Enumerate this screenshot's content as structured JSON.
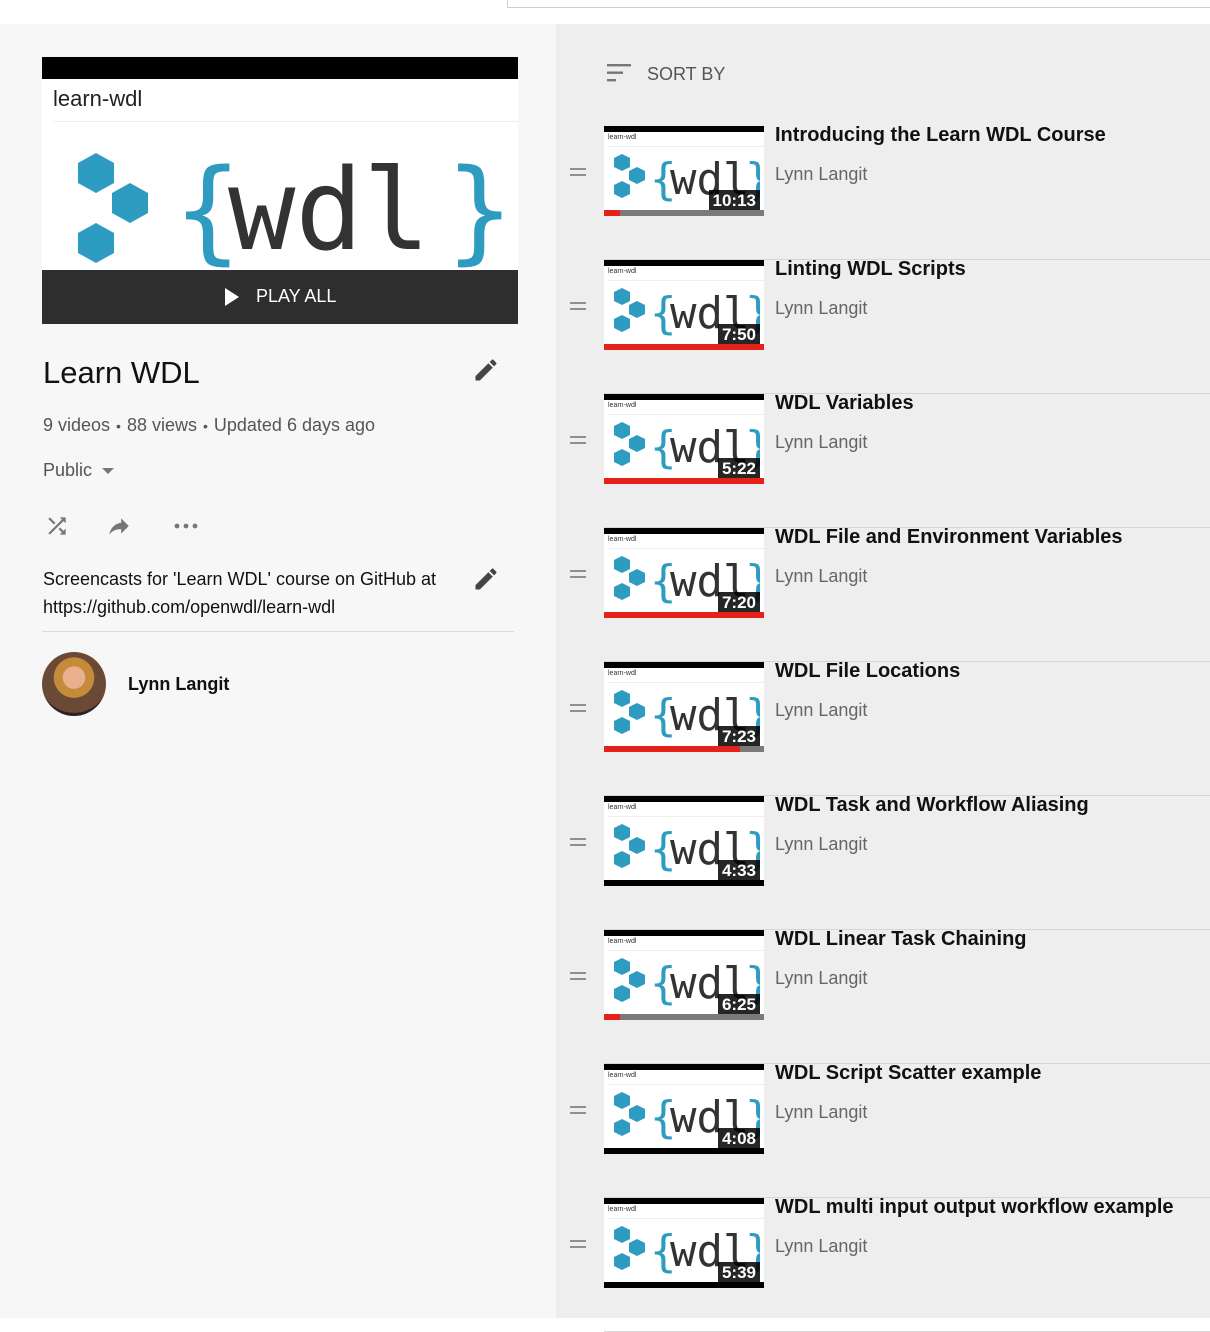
{
  "playlist": {
    "thumbnail_caption": "learn-wdl",
    "logo_text": "{wdl}",
    "play_all_label": "PLAY ALL",
    "title": "Learn WDL",
    "stats": {
      "videos": "9 videos",
      "views": "88 views",
      "updated": "Updated 6 days ago"
    },
    "privacy": "Public",
    "description": "Screencasts for 'Learn WDL' course on GitHub at https://github.com/openwdl/learn-wdl",
    "owner": "Lynn Langit"
  },
  "list": {
    "sort_label": "SORT BY",
    "videos": [
      {
        "title": "Introducing the Learn WDL Course",
        "owner": "Lynn Langit",
        "duration": "10:13",
        "progress": 0.1
      },
      {
        "title": "Linting WDL Scripts",
        "owner": "Lynn Langit",
        "duration": "7:50",
        "progress": 1.0
      },
      {
        "title": "WDL Variables",
        "owner": "Lynn Langit",
        "duration": "5:22",
        "progress": 1.0
      },
      {
        "title": "WDL File and Environment Variables",
        "owner": "Lynn Langit",
        "duration": "7:20",
        "progress": 1.0
      },
      {
        "title": "WDL File Locations",
        "owner": "Lynn Langit",
        "duration": "7:23",
        "progress": 0.85
      },
      {
        "title": "WDL Task and Workflow Aliasing",
        "owner": "Lynn Langit",
        "duration": "4:33",
        "progress": 0
      },
      {
        "title": "WDL Linear Task Chaining",
        "owner": "Lynn Langit",
        "duration": "6:25",
        "progress": 0.1
      },
      {
        "title": "WDL Script Scatter example",
        "owner": "Lynn Langit",
        "duration": "4:08",
        "progress": 0
      },
      {
        "title": "WDL multi input output workflow example",
        "owner": "Lynn Langit",
        "duration": "5:39",
        "progress": 0
      }
    ]
  },
  "colors": {
    "accent_red": "#e62117",
    "logo_blue": "#2e9bc1",
    "left_panel_bg": "#f7f7f7",
    "right_panel_bg": "#eeeeee"
  },
  "icons": {
    "edit": "pencil-icon",
    "shuffle": "shuffle-icon",
    "share": "share-icon",
    "more": "more-horiz-icon",
    "sort": "sort-icon",
    "drag": "drag-handle-icon",
    "play": "play-icon"
  }
}
